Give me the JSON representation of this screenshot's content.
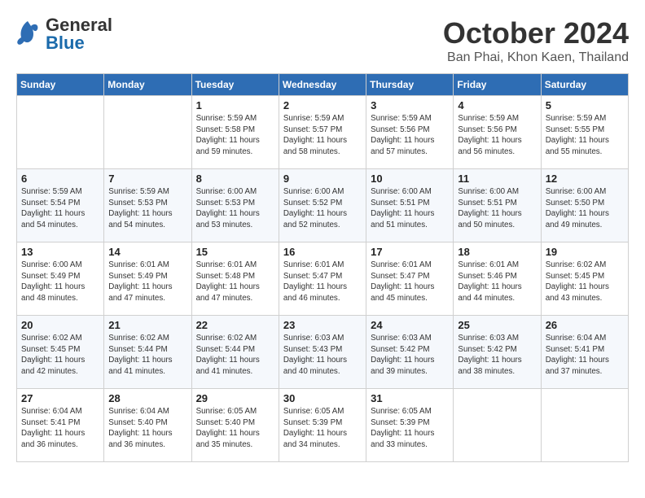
{
  "logo": {
    "general": "General",
    "blue": "Blue"
  },
  "title": "October 2024",
  "location": "Ban Phai, Khon Kaen, Thailand",
  "weekdays": [
    "Sunday",
    "Monday",
    "Tuesday",
    "Wednesday",
    "Thursday",
    "Friday",
    "Saturday"
  ],
  "weeks": [
    [
      {
        "day": "",
        "info": ""
      },
      {
        "day": "",
        "info": ""
      },
      {
        "day": "1",
        "info": "Sunrise: 5:59 AM\nSunset: 5:58 PM\nDaylight: 11 hours and 59 minutes."
      },
      {
        "day": "2",
        "info": "Sunrise: 5:59 AM\nSunset: 5:57 PM\nDaylight: 11 hours and 58 minutes."
      },
      {
        "day": "3",
        "info": "Sunrise: 5:59 AM\nSunset: 5:56 PM\nDaylight: 11 hours and 57 minutes."
      },
      {
        "day": "4",
        "info": "Sunrise: 5:59 AM\nSunset: 5:56 PM\nDaylight: 11 hours and 56 minutes."
      },
      {
        "day": "5",
        "info": "Sunrise: 5:59 AM\nSunset: 5:55 PM\nDaylight: 11 hours and 55 minutes."
      }
    ],
    [
      {
        "day": "6",
        "info": "Sunrise: 5:59 AM\nSunset: 5:54 PM\nDaylight: 11 hours and 54 minutes."
      },
      {
        "day": "7",
        "info": "Sunrise: 5:59 AM\nSunset: 5:53 PM\nDaylight: 11 hours and 54 minutes."
      },
      {
        "day": "8",
        "info": "Sunrise: 6:00 AM\nSunset: 5:53 PM\nDaylight: 11 hours and 53 minutes."
      },
      {
        "day": "9",
        "info": "Sunrise: 6:00 AM\nSunset: 5:52 PM\nDaylight: 11 hours and 52 minutes."
      },
      {
        "day": "10",
        "info": "Sunrise: 6:00 AM\nSunset: 5:51 PM\nDaylight: 11 hours and 51 minutes."
      },
      {
        "day": "11",
        "info": "Sunrise: 6:00 AM\nSunset: 5:51 PM\nDaylight: 11 hours and 50 minutes."
      },
      {
        "day": "12",
        "info": "Sunrise: 6:00 AM\nSunset: 5:50 PM\nDaylight: 11 hours and 49 minutes."
      }
    ],
    [
      {
        "day": "13",
        "info": "Sunrise: 6:00 AM\nSunset: 5:49 PM\nDaylight: 11 hours and 48 minutes."
      },
      {
        "day": "14",
        "info": "Sunrise: 6:01 AM\nSunset: 5:49 PM\nDaylight: 11 hours and 47 minutes."
      },
      {
        "day": "15",
        "info": "Sunrise: 6:01 AM\nSunset: 5:48 PM\nDaylight: 11 hours and 47 minutes."
      },
      {
        "day": "16",
        "info": "Sunrise: 6:01 AM\nSunset: 5:47 PM\nDaylight: 11 hours and 46 minutes."
      },
      {
        "day": "17",
        "info": "Sunrise: 6:01 AM\nSunset: 5:47 PM\nDaylight: 11 hours and 45 minutes."
      },
      {
        "day": "18",
        "info": "Sunrise: 6:01 AM\nSunset: 5:46 PM\nDaylight: 11 hours and 44 minutes."
      },
      {
        "day": "19",
        "info": "Sunrise: 6:02 AM\nSunset: 5:45 PM\nDaylight: 11 hours and 43 minutes."
      }
    ],
    [
      {
        "day": "20",
        "info": "Sunrise: 6:02 AM\nSunset: 5:45 PM\nDaylight: 11 hours and 42 minutes."
      },
      {
        "day": "21",
        "info": "Sunrise: 6:02 AM\nSunset: 5:44 PM\nDaylight: 11 hours and 41 minutes."
      },
      {
        "day": "22",
        "info": "Sunrise: 6:02 AM\nSunset: 5:44 PM\nDaylight: 11 hours and 41 minutes."
      },
      {
        "day": "23",
        "info": "Sunrise: 6:03 AM\nSunset: 5:43 PM\nDaylight: 11 hours and 40 minutes."
      },
      {
        "day": "24",
        "info": "Sunrise: 6:03 AM\nSunset: 5:42 PM\nDaylight: 11 hours and 39 minutes."
      },
      {
        "day": "25",
        "info": "Sunrise: 6:03 AM\nSunset: 5:42 PM\nDaylight: 11 hours and 38 minutes."
      },
      {
        "day": "26",
        "info": "Sunrise: 6:04 AM\nSunset: 5:41 PM\nDaylight: 11 hours and 37 minutes."
      }
    ],
    [
      {
        "day": "27",
        "info": "Sunrise: 6:04 AM\nSunset: 5:41 PM\nDaylight: 11 hours and 36 minutes."
      },
      {
        "day": "28",
        "info": "Sunrise: 6:04 AM\nSunset: 5:40 PM\nDaylight: 11 hours and 36 minutes."
      },
      {
        "day": "29",
        "info": "Sunrise: 6:05 AM\nSunset: 5:40 PM\nDaylight: 11 hours and 35 minutes."
      },
      {
        "day": "30",
        "info": "Sunrise: 6:05 AM\nSunset: 5:39 PM\nDaylight: 11 hours and 34 minutes."
      },
      {
        "day": "31",
        "info": "Sunrise: 6:05 AM\nSunset: 5:39 PM\nDaylight: 11 hours and 33 minutes."
      },
      {
        "day": "",
        "info": ""
      },
      {
        "day": "",
        "info": ""
      }
    ]
  ]
}
